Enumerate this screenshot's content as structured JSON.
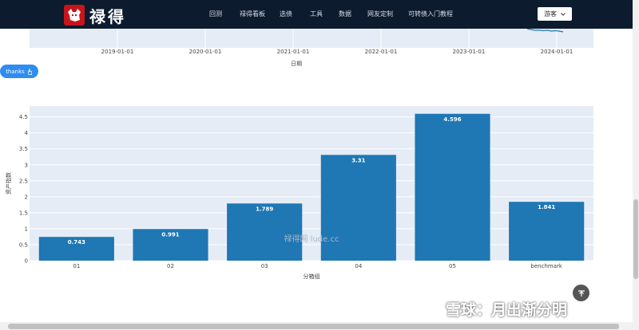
{
  "header": {
    "brand": "禄得",
    "nav": [
      "回测",
      "禄得看板",
      "选债",
      "工具",
      "数据",
      "网友定制",
      "可转债入门教程"
    ],
    "user_button": "游客",
    "bg_color": "#0d1b2e"
  },
  "thanks_button": {
    "label": "thanks",
    "icon": "hand-icon",
    "color": "#2f8cf0"
  },
  "top_chart": {
    "x_ticks": [
      "2019-01-01",
      "2020-01-01",
      "2021-01-01",
      "2022-01-01",
      "2023-01-01",
      "2024-01-01"
    ],
    "xlabel": "日期"
  },
  "watermarks": {
    "center": "禄得网 lude.cc",
    "corner": "雪球：月出渐分明"
  },
  "back_to_top": {
    "icon": "arrow-up-icon"
  },
  "chart_data": {
    "type": "bar",
    "categories": [
      "01",
      "02",
      "03",
      "04",
      "05",
      "benchmark"
    ],
    "values": [
      0.743,
      0.991,
      1.789,
      3.31,
      4.596,
      1.841
    ],
    "data_labels": [
      "0.743",
      "0.991",
      "1.789",
      "3.31",
      "4.596",
      "1.841"
    ],
    "xlabel": "分箱组",
    "ylabel": "资产指数",
    "ylim": [
      0,
      4.84
    ],
    "yticks": [
      0,
      0.5,
      1,
      1.5,
      2,
      2.5,
      3,
      3.5,
      4,
      4.5
    ],
    "ytick_labels": [
      "0",
      "0.5",
      "1",
      "1.5",
      "2",
      "2.5",
      "3",
      "3.5",
      "4",
      "4.5"
    ],
    "bar_color": "#1f77b4",
    "plot_bg": "#e5ecf6",
    "grid": true
  }
}
